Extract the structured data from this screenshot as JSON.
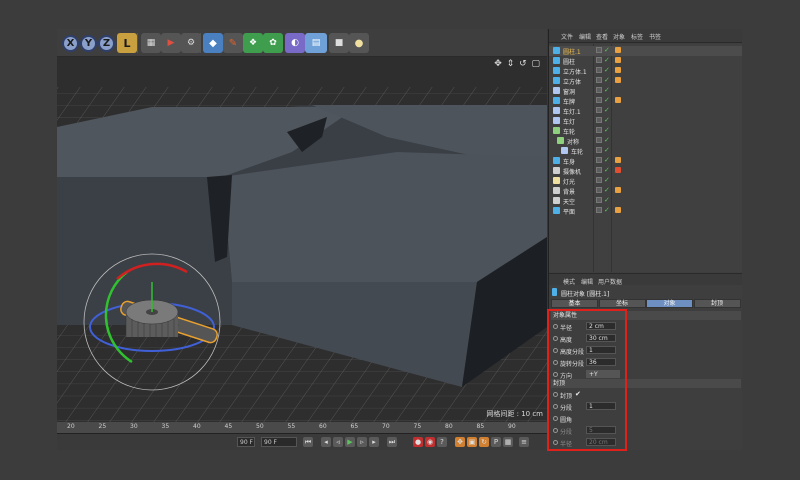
{
  "toolbar": {
    "axis_x": "X",
    "axis_y": "Y",
    "axis_z": "Z",
    "icons": [
      "coordinate-system-icon",
      "render-view-icon",
      "render-picture-icon",
      "render-settings-icon",
      "cube-icon",
      "pen-icon",
      "subdivision-icon",
      "array-icon",
      "deformer-icon",
      "floor-icon",
      "camera-icon",
      "light-icon"
    ]
  },
  "viewport": {
    "nav": "✥ ⇕ ↺ ▢",
    "grid_spacing": "网格间距 : 10 cm"
  },
  "timeline": {
    "ticks": [
      "20",
      "25",
      "30",
      "35",
      "40",
      "45",
      "50",
      "55",
      "60",
      "65",
      "70",
      "75",
      "80",
      "85",
      "90"
    ],
    "end_frame_field": "90 F",
    "current_field": "90 F"
  },
  "object_manager": {
    "menu": [
      "文件",
      "编辑",
      "查看",
      "对象",
      "标签",
      "书签"
    ],
    "objects": [
      {
        "name": "圆柱.1",
        "color": "#4fb0e8",
        "tag": "#e8a040",
        "selected": true
      },
      {
        "name": "圆柱",
        "color": "#4fb0e8",
        "tag": "#e8a040"
      },
      {
        "name": "立方体.1",
        "color": "#4fb0e8",
        "tag": "#e8a040"
      },
      {
        "name": "立方体",
        "color": "#4fb0e8",
        "tag": "#e8a040"
      },
      {
        "name": "窗洞",
        "color": "#b0c8f0",
        "tag": ""
      },
      {
        "name": "车牌",
        "color": "#4fb0e8",
        "tag": "#e8a040"
      },
      {
        "name": "车灯.1",
        "color": "#b0c8f0",
        "tag": ""
      },
      {
        "name": "车灯",
        "color": "#b0c8f0",
        "tag": ""
      },
      {
        "name": "车轮",
        "color": "#8fd07f",
        "tag": ""
      },
      {
        "name": "对称",
        "color": "#8fd07f",
        "tag": ""
      },
      {
        "name": "车轮",
        "color": "#b0c8f0",
        "tag": ""
      },
      {
        "name": "车身",
        "color": "#4fb0e8",
        "tag": "#e8a040"
      },
      {
        "name": "摄像机",
        "color": "#cfcfcf",
        "tag": "#e05030"
      },
      {
        "name": "灯光",
        "color": "#f0e0a0",
        "tag": ""
      },
      {
        "name": "背景",
        "color": "#cfcfcf",
        "tag": "#e8a040"
      },
      {
        "name": "天空",
        "color": "#cfcfcf",
        "tag": ""
      },
      {
        "name": "平面",
        "color": "#4fb0e8",
        "tag": "#e8a040"
      }
    ]
  },
  "attributes": {
    "menu": [
      "模式",
      "编辑",
      "用户数据"
    ],
    "title": "圆柱对象 [圆柱.1]",
    "tabs": [
      "基本",
      "坐标",
      "对象",
      "封顶"
    ],
    "active_tab": "对象",
    "object_section": "对象属性",
    "object_props": [
      {
        "label": "半径",
        "value": "2 cm"
      },
      {
        "label": "高度",
        "value": "30 cm"
      },
      {
        "label": "高度分段",
        "value": "1"
      },
      {
        "label": "旋转分段",
        "value": "36"
      },
      {
        "label": "方向",
        "value": "+Y",
        "dropdown": true
      }
    ],
    "caps_section": "封顶",
    "caps_props": [
      {
        "label": "封顶",
        "value": "✔",
        "checkbox": true
      },
      {
        "label": "分段",
        "value": "1"
      },
      {
        "label": "圆角",
        "value": "",
        "checkbox": true
      },
      {
        "label": "分段",
        "value": "5",
        "disabled": true
      },
      {
        "label": "半径",
        "value": "20 cm",
        "disabled": true
      }
    ]
  },
  "colors": {
    "active_tab": "#6e8fc2",
    "highlight_box": "#e0201a"
  }
}
